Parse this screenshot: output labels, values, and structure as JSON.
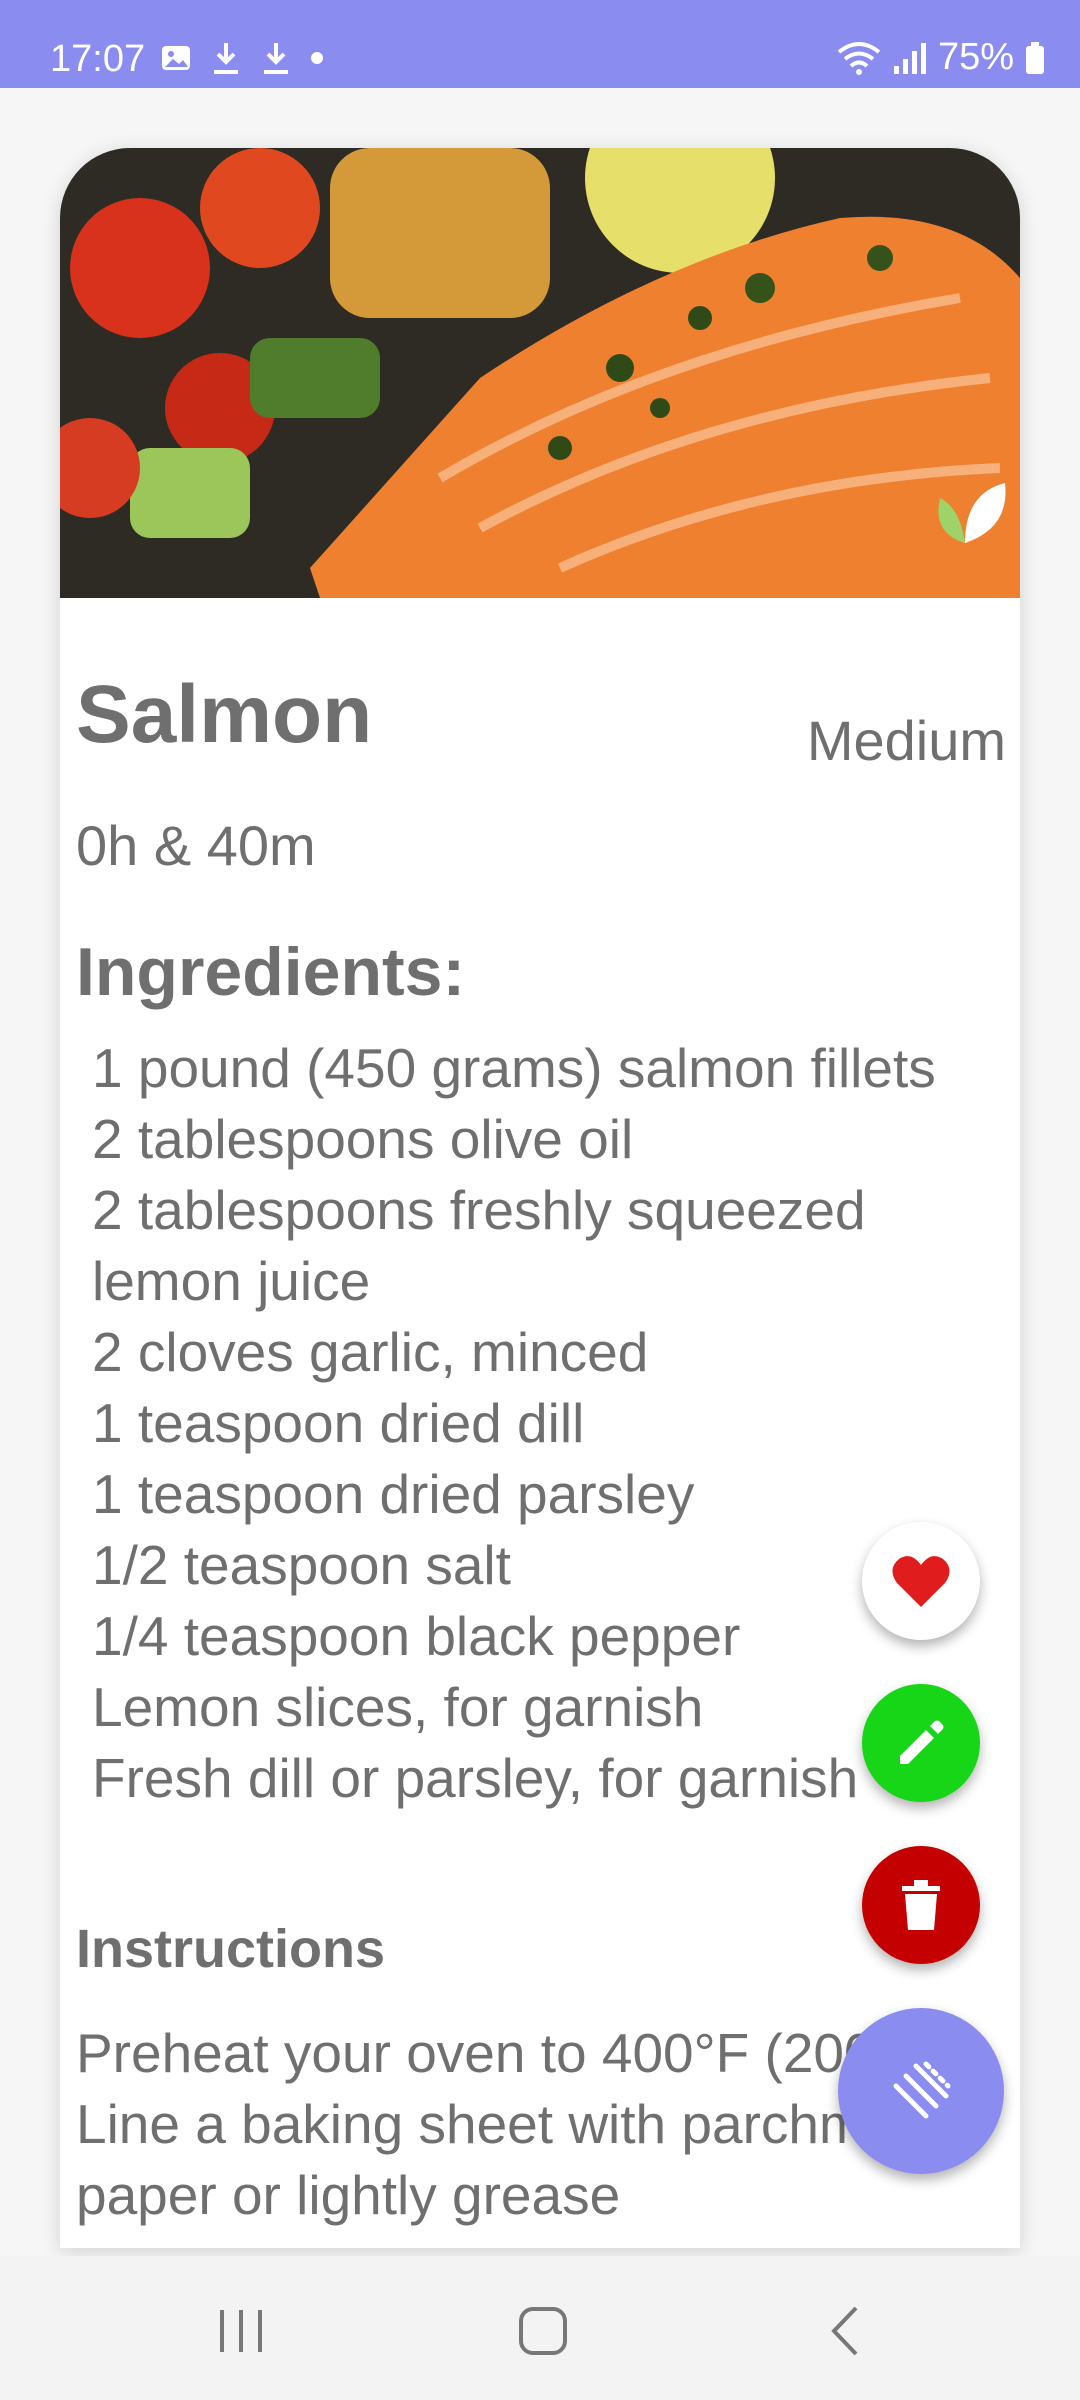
{
  "status_bar": {
    "time": "17:07",
    "battery": "75%",
    "icons": [
      "gallery-icon",
      "download-icon",
      "download-icon",
      "dot-icon",
      "wifi-icon",
      "signal-icon",
      "battery-icon"
    ]
  },
  "recipe": {
    "name": "Salmon",
    "difficulty": "Medium",
    "duration": "0h & 40m",
    "ingredients_heading": "Ingredients:",
    "ingredients": [
      "1 pound (450 grams) salmon fillets",
      "2 tablespoons olive oil",
      "2 tablespoons freshly squeezed lemon juice",
      "2 cloves garlic, minced",
      "1 teaspoon dried dill",
      "1 teaspoon dried parsley",
      "1/2 teaspoon salt",
      "1/4 teaspoon black pepper",
      "Lemon slices, for garnish",
      "Fresh dill or parsley, for garnish"
    ],
    "instructions_heading": "Instructions",
    "instructions": "Preheat your oven to 400°F (200°C). Line a baking sheet with parchment paper or lightly grease"
  },
  "colors": {
    "accent": "#8a8cf0",
    "favorite": "#e01c1c",
    "edit": "#17d517",
    "delete": "#c40000",
    "text": "#6f6f6f"
  }
}
